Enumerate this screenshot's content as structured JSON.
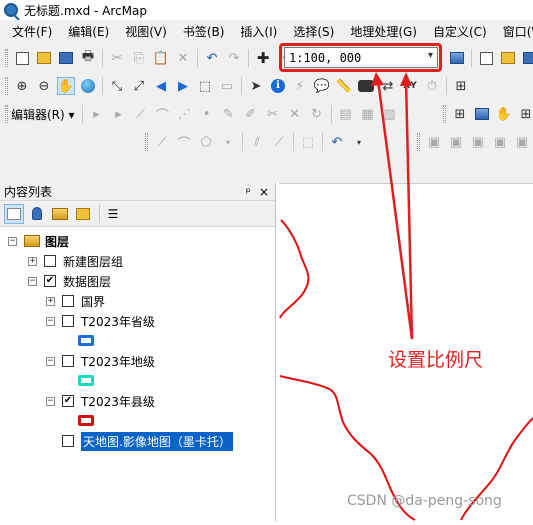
{
  "window": {
    "title": "无标题.mxd - ArcMap"
  },
  "menubar": {
    "items": [
      "文件(F)",
      "编辑(E)",
      "视图(V)",
      "书签(B)",
      "插入(I)",
      "选择(S)",
      "地理处理(G)",
      "自定义(C)",
      "窗口(W)"
    ]
  },
  "toolbar": {
    "scale_value": "1:100, 000",
    "editor_label": "编辑器(R) ▾"
  },
  "toc": {
    "title": "内容列表",
    "pin": "ᵖ",
    "close": "×",
    "tree": [
      {
        "label": "图层",
        "level": 0,
        "expander": "−",
        "checked": null
      },
      {
        "label": "新建图层组",
        "level": 1,
        "expander": "+",
        "checked": false
      },
      {
        "label": "数据图层",
        "level": 1,
        "expander": "−",
        "checked": true
      },
      {
        "label": "国界",
        "level": 2,
        "expander": "+",
        "checked": false
      },
      {
        "label": "T2023年省级",
        "level": 2,
        "expander": "−",
        "checked": false
      },
      {
        "label": "T2023年地级",
        "level": 2,
        "expander": "−",
        "checked": false
      },
      {
        "label": "T2023年县级",
        "level": 2,
        "expander": "−",
        "checked": true
      },
      {
        "label": "天地图.影像地图（墨卡托）",
        "level": 2,
        "expander": null,
        "checked": false,
        "selected": true
      }
    ],
    "swatch_colors": {
      "province": "#1a6fe0",
      "prefecture": "#12e0c0",
      "county": "#d01010"
    }
  },
  "annotation": {
    "text": "设置比例尺",
    "color": "#e02020"
  },
  "watermark": {
    "text": "CSDN @da-peng-song"
  },
  "map": {
    "boundary_color": "#e01010"
  }
}
